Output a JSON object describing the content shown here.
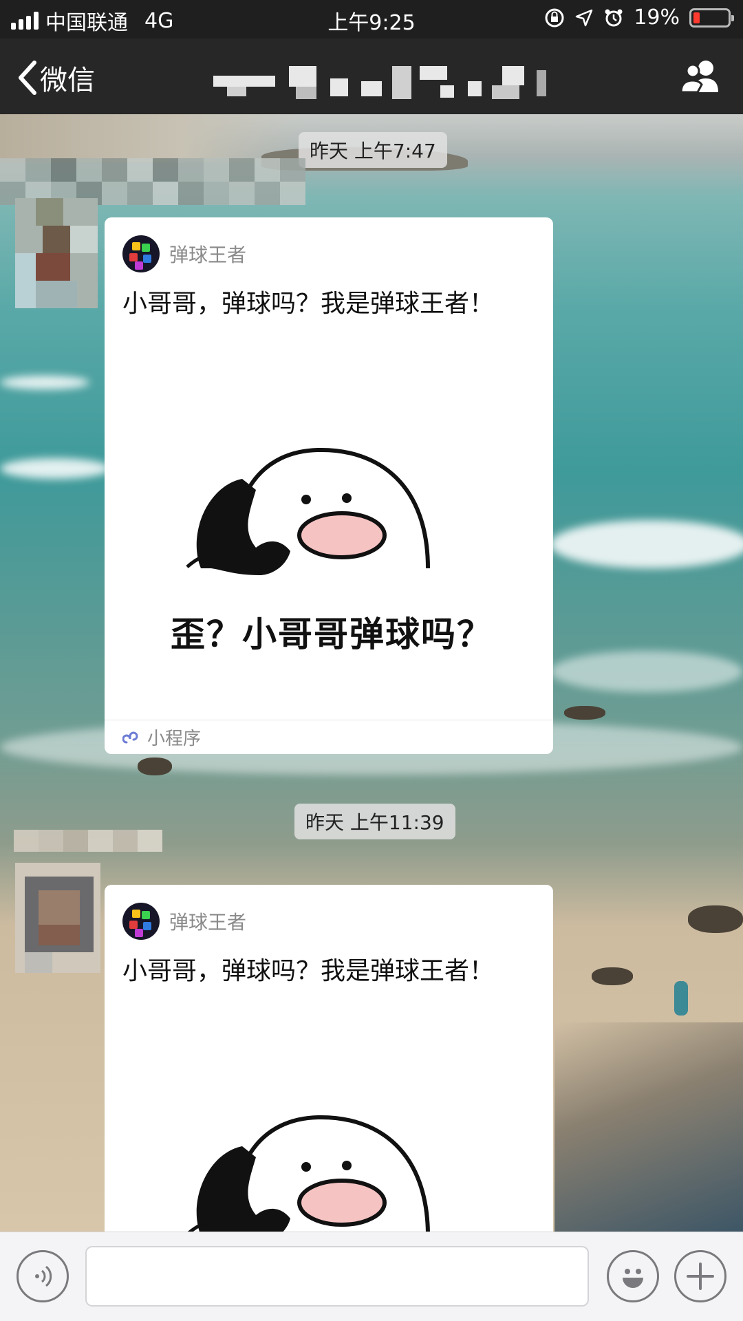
{
  "status_bar": {
    "carrier": "中国联通",
    "network": "4G",
    "time": "上午9:25",
    "battery": "19%",
    "battery_level": 0.19
  },
  "nav": {
    "back_label": "微信",
    "title": "",
    "people_icon": "group-icon"
  },
  "messages": [
    {
      "timestamp": "昨天 上午7:47",
      "card": {
        "app_name": "弹球王者",
        "text": "小哥哥，弹球吗？我是弹球王者！",
        "meme_caption": "歪？小哥哥弹球吗？",
        "footer": "小程序",
        "footer_icon": "mini-program-icon"
      }
    },
    {
      "timestamp": "昨天 上午11:39",
      "card": {
        "app_name": "弹球王者",
        "text": "小哥哥，弹球吗？我是弹球王者！",
        "meme_caption": "",
        "footer": "",
        "footer_icon": ""
      }
    }
  ],
  "input_bar": {
    "voice_icon": "voice-icon",
    "text_value": "",
    "emoji_icon": "emoji-icon",
    "add_icon": "plus-icon"
  }
}
